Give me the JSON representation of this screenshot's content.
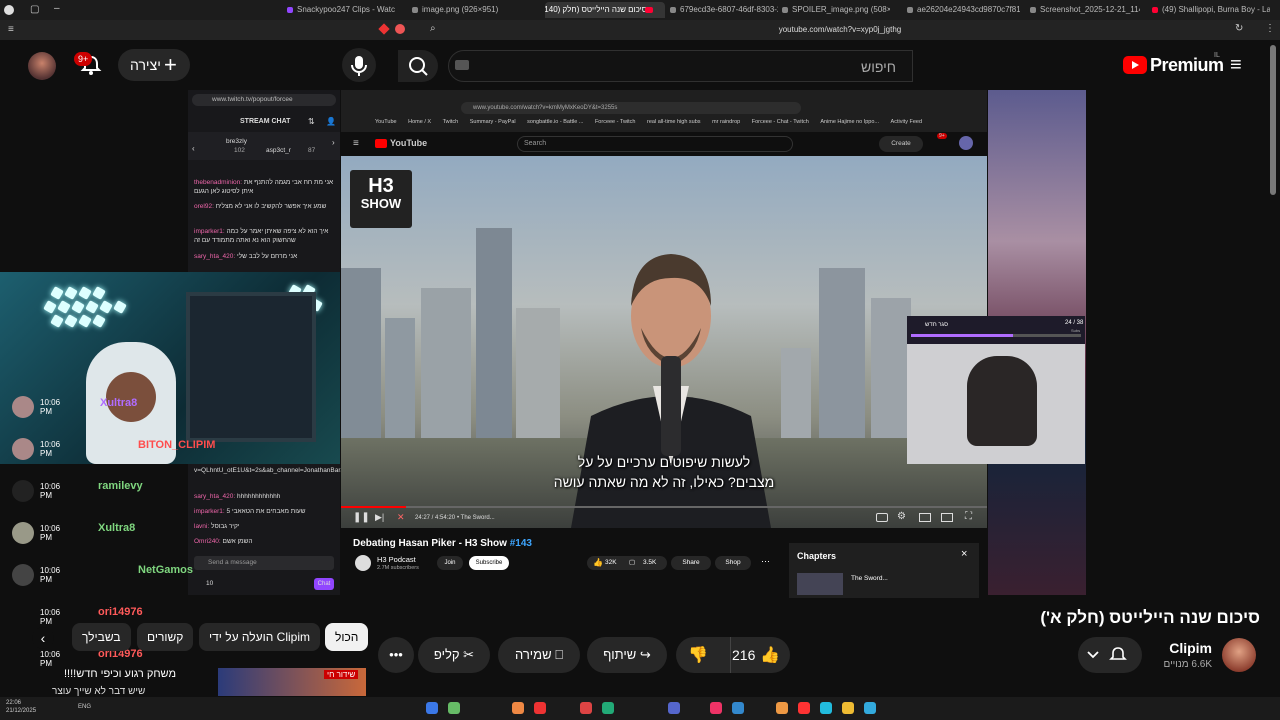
{
  "tabs": [
    {
      "label": "Snackypoo247 Clips - Watch Live on"
    },
    {
      "label": "image.png (926×951)"
    },
    {
      "label": "סיכום שנה היילייטס (חלק (140)"
    },
    {
      "label": "679ecd3e-6807-46df-8303-2fe0dd9c"
    },
    {
      "label": "SPOILER_image.png (508×372)"
    },
    {
      "label": "ae26204e24943cd9870c7f81f05570"
    },
    {
      "label": "Screenshot_2025-12-21_114606.png"
    },
    {
      "label": "(49) Shallipopi, Burna Boy - Laho II ("
    }
  ],
  "address": "youtube.com/watch?v=xyp0j_jgthg",
  "header": {
    "notif_count": "9+",
    "create_label": "יצירה",
    "search_placeholder": "חיפוש",
    "brand": "Premium",
    "brand_region": "IL"
  },
  "twitch": {
    "url": "www.twitch.tv/popout/forcee",
    "stream_chat": "STREAM CHAT",
    "viewer1": "bre3zly",
    "viewer1_count": "102",
    "viewer2": "asp3ct_r",
    "viewer2_count": "87",
    "lines": [
      {
        "user": "thebenadminion:",
        "text": "אני מת חח אבי מגמה להתנף את איתן לסיטוג לאן הגעם"
      },
      {
        "user": "orel92:",
        "text": "שמע איך אפשר להקשיב לו אני לא מצליח"
      },
      {
        "user": "imparker1:",
        "text": "איך הוא לא ציפה שאיתן יאמר על כמה שהחשוק הוא נא ואתה מתמודד עם זה"
      },
      {
        "user": "sary_hta_420:",
        "text": "אני מרחם על לבב שלי"
      },
      {
        "user": "",
        "text": "v=QLhntU_otE1U&t=2s&ab_channel=JonathanBarak"
      },
      {
        "user": "sary_hta_420:",
        "text": "hhhhhhhhhhhh"
      },
      {
        "user": "imparker1:",
        "text": "שעות מאבחים את הטאאבי 5"
      },
      {
        "user": "lavni:",
        "text": "יקיר גבוסל"
      },
      {
        "user": "Omri240:",
        "text": "השמן אשם"
      }
    ],
    "send_placeholder": "Send a message",
    "points": "10",
    "chat_button": "Chat"
  },
  "inner_browser": {
    "url": "www.youtube.com/watch?v=kmMyMxKeoDY&t=3255s",
    "bookmarks": [
      "YouTube",
      "Home / X",
      "Twitch",
      "Summary - PayPal",
      "songbattle.io - Battle ...",
      "Forceee - Twitch",
      "real all-time high subs",
      "mr raindrop",
      "Forceee - Chat - Twitch",
      "Anime Hajime no Ippo...",
      "Activity Feed"
    ],
    "yt_logo": "YouTube",
    "search": "Search",
    "create": "Create",
    "notif": "9+"
  },
  "video": {
    "badge_line1": "H3",
    "badge_line2": "SHOW",
    "subtitle_line1": "לעשות שיפוטים ערכיים על על",
    "subtitle_line2": "מצבים? כאילו, זה לא מה שאתה עושה",
    "time": "24:27 / 4:54:20",
    "chapter_label": "• The Sword...",
    "title": "Debating Hasan Piker - H3 Show",
    "episode": "#143",
    "channel": "H3 Podcast",
    "subs": "2.7M subscribers",
    "join": "Join",
    "subscribe": "Subscribe",
    "likes": "32K",
    "comments": "3.5K",
    "share": "Share",
    "shop": "Shop"
  },
  "mini_overlay": {
    "title": "סגר חדש",
    "counter": "24 / 38",
    "sub": "Subs"
  },
  "chapters": {
    "title": "Chapters",
    "item": "The Sword..."
  },
  "cam_overlay": {
    "name1": "Xultra8",
    "name2": "BITON_CLIPIM"
  },
  "chat": [
    {
      "time": "10:06 PM",
      "name": "ramilevy",
      "color": "#7fd67f"
    },
    {
      "time": "10:06 PM",
      "name": "Xultra8",
      "color": "#7fd67f"
    },
    {
      "time": "10:06 PM",
      "name": "NetGamos",
      "color": "#7fd67f"
    },
    {
      "time": "10:06 PM",
      "name": "ori14976",
      "color": "#ff5a5a"
    },
    {
      "time": "10:06 PM",
      "name": "ori14976",
      "color": "#ff5a5a"
    }
  ],
  "chat_text": "משחק רגוע וכיפי חדש!!!!",
  "chat_text2": "שיש דבר לא שייך עוצר",
  "main": {
    "video_title": "סיכום שנה היילייטס (חלק א')",
    "channel_name": "Clipim",
    "subscribers": "6.6K מנויים",
    "like_count": "216",
    "share_label": "שיתוף",
    "save_label": "שמירה",
    "clip_label": "קליפ",
    "chips": [
      "הכול",
      "הועלה על ידי Clipim",
      "קשורים",
      "בשבילך"
    ],
    "gaming_text": "שידור חי"
  },
  "taskbar": {
    "time": "22:06",
    "date": "21/12/2025",
    "lang": "ENG"
  }
}
